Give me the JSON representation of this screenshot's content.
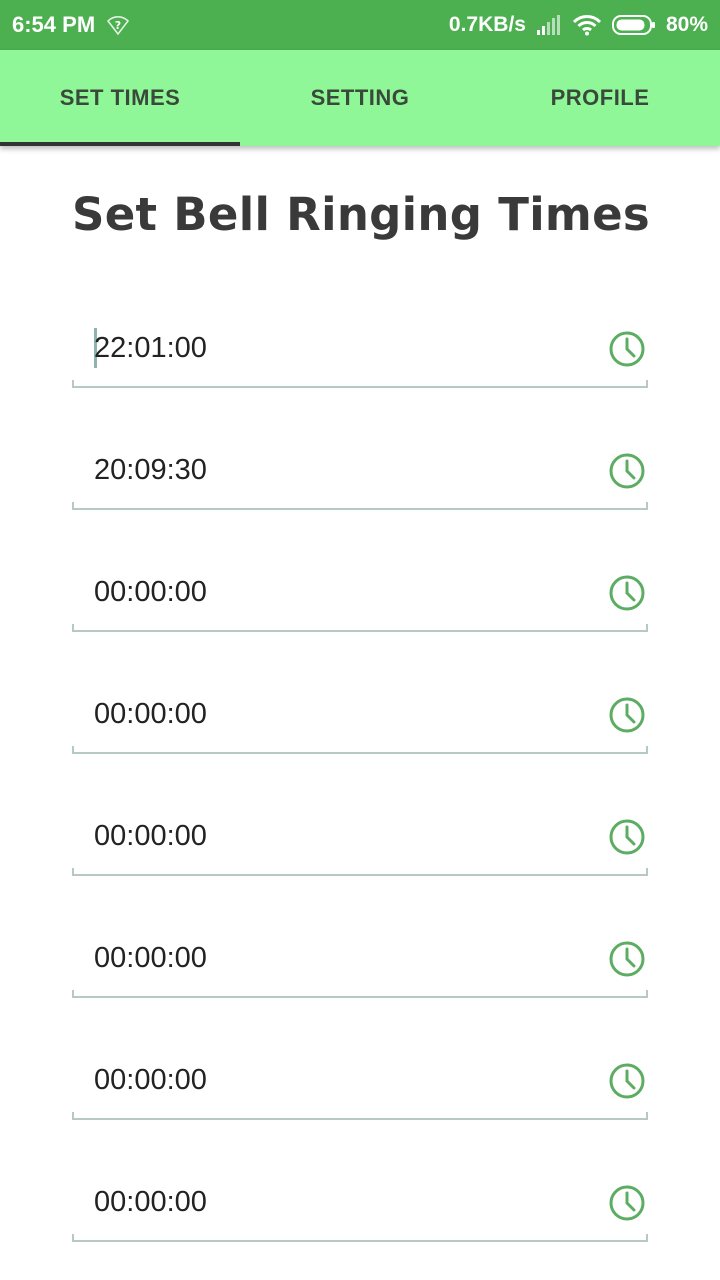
{
  "status_bar": {
    "time": "6:54 PM",
    "network_speed": "0.7KB/s",
    "battery_percent": "80%",
    "accent_color": "#4caf50"
  },
  "tabs": [
    {
      "label": "SET TIMES",
      "active": true
    },
    {
      "label": "SETTING",
      "active": false
    },
    {
      "label": "PROFILE",
      "active": false
    }
  ],
  "tab_bar_color": "#90f798",
  "page": {
    "title": "Set Bell Ringing Times"
  },
  "times": [
    {
      "value": "22:01:00",
      "icon": "clock-icon"
    },
    {
      "value": "20:09:30",
      "icon": "clock-icon"
    },
    {
      "value": "00:00:00",
      "icon": "clock-icon"
    },
    {
      "value": "00:00:00",
      "icon": "clock-icon"
    },
    {
      "value": "00:00:00",
      "icon": "clock-icon"
    },
    {
      "value": "00:00:00",
      "icon": "clock-icon"
    },
    {
      "value": "00:00:00",
      "icon": "clock-icon"
    },
    {
      "value": "00:00:00",
      "icon": "clock-icon"
    }
  ],
  "icon_color": "#5cad62"
}
